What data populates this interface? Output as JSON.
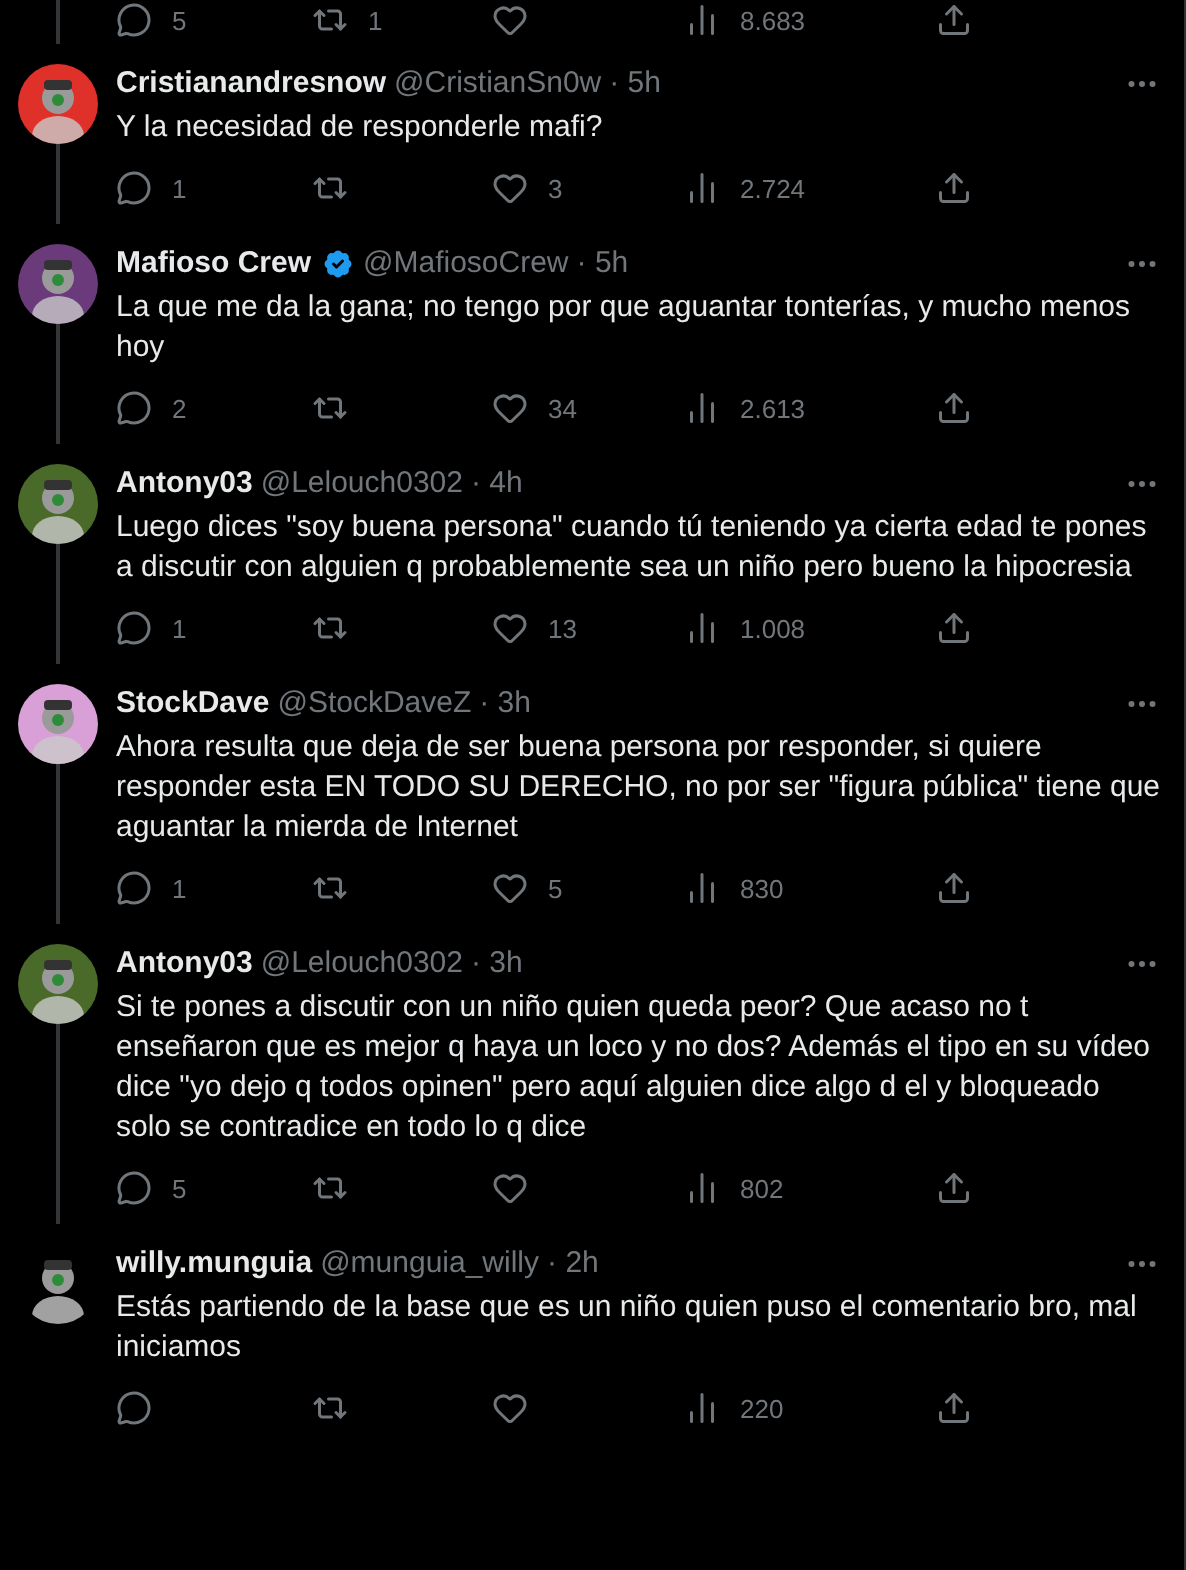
{
  "previous_actions": {
    "replies": "5",
    "retweets": "1",
    "views": "8.683"
  },
  "tweets": [
    {
      "name": "Cristianandresnow",
      "verified": false,
      "handle": "@CristianSn0w",
      "time": "· 5h",
      "text": "Y la necesidad de responderle mafi?",
      "replies": "1",
      "likes": "3",
      "views": "2.724",
      "thread_below": true
    },
    {
      "name": "Mafioso Crew",
      "verified": true,
      "handle": "@MafiosoCrew",
      "time": "· 5h",
      "text": "La que me da la gana; no tengo por que aguantar tonterías, y mucho menos hoy",
      "replies": "2",
      "likes": "34",
      "views": "2.613",
      "thread_below": true
    },
    {
      "name": "Antony03",
      "verified": false,
      "handle": "@Lelouch0302",
      "time": "· 4h",
      "text": "Luego dices \"soy buena persona\" cuando tú teniendo ya cierta edad te pones a discutir con alguien q probablemente sea un niño pero bueno la hipocresia",
      "replies": "1",
      "likes": "13",
      "views": "1.008",
      "thread_below": true
    },
    {
      "name": "StockDave",
      "verified": false,
      "handle": "@StockDaveZ",
      "time": "· 3h",
      "text": "Ahora resulta que deja de ser buena persona por responder, si quiere responder esta EN TODO SU DERECHO, no por ser \"figura pública\" tiene que aguantar la mierda de Internet",
      "replies": "1",
      "likes": "5",
      "views": "830",
      "thread_below": true
    },
    {
      "name": "Antony03",
      "verified": false,
      "handle": "@Lelouch0302",
      "time": "· 3h",
      "text": "Si te pones a discutir con un niño quien queda peor? Que acaso no t enseñaron que es mejor q haya un loco y no dos? Además el tipo en su vídeo dice \"yo dejo q todos opinen\" pero aquí alguien dice algo d el y bloqueado solo se contradice en todo lo q dice",
      "replies": "5",
      "views": "802",
      "thread_below": true
    },
    {
      "name": "willy.munguia",
      "verified": false,
      "handle": "@munguia_willy",
      "time": "· 2h",
      "text": "Estás partiendo de la base que es un niño quien puso el comentario bro, mal iniciamos",
      "views": "220",
      "thread_below": false
    }
  ]
}
